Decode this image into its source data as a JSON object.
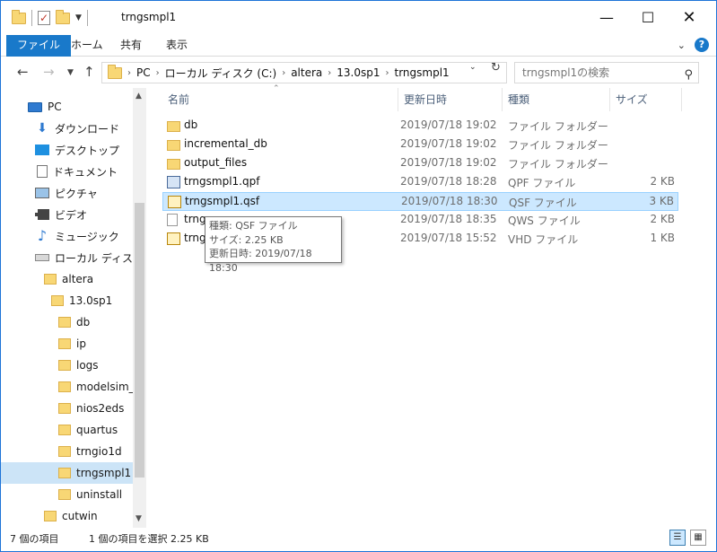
{
  "window": {
    "title": "trngsmpl1",
    "qat_icons": [
      "folder-icon",
      "properties-check-icon",
      "new-folder-icon",
      "customize-qat-icon"
    ],
    "controls": {
      "minimize": "—",
      "maximize": "☐",
      "close": "✕"
    }
  },
  "ribbon": {
    "tabs": [
      "ファイル",
      "ホーム",
      "共有",
      "表示"
    ],
    "active_tab": "ファイル",
    "accent_color": "#1979ca"
  },
  "navigation": {
    "breadcrumbs": [
      "PC",
      "ローカル ディスク (C:)",
      "altera",
      "13.0sp1",
      "trngsmpl1"
    ],
    "search_placeholder": "trngsmpl1の検索"
  },
  "sidebar": {
    "items": [
      {
        "label": "PC",
        "icon": "pc-icon"
      },
      {
        "label": "ダウンロード",
        "icon": "download-icon"
      },
      {
        "label": "デスクトップ",
        "icon": "desktop-icon"
      },
      {
        "label": "ドキュメント",
        "icon": "document-icon"
      },
      {
        "label": "ピクチャ",
        "icon": "pictures-icon"
      },
      {
        "label": "ビデオ",
        "icon": "video-icon"
      },
      {
        "label": "ミュージック",
        "icon": "music-icon"
      },
      {
        "label": "ローカル ディスク (C",
        "icon": "disk-icon"
      },
      {
        "label": "altera",
        "icon": "folder-icon"
      },
      {
        "label": "13.0sp1",
        "icon": "folder-icon"
      },
      {
        "label": "db",
        "icon": "folder-icon"
      },
      {
        "label": "ip",
        "icon": "folder-icon"
      },
      {
        "label": "logs",
        "icon": "folder-icon"
      },
      {
        "label": "modelsim_a",
        "icon": "folder-icon"
      },
      {
        "label": "nios2eds",
        "icon": "folder-icon"
      },
      {
        "label": "quartus",
        "icon": "folder-icon"
      },
      {
        "label": "trngio1d",
        "icon": "folder-icon"
      },
      {
        "label": "trngsmpl1",
        "icon": "folder-icon",
        "selected": true
      },
      {
        "label": "uninstall",
        "icon": "folder-icon"
      },
      {
        "label": "cutwin",
        "icon": "folder-icon"
      }
    ]
  },
  "file_list": {
    "columns": [
      "名前",
      "更新日時",
      "種類",
      "サイズ"
    ],
    "rows": [
      {
        "name": "db",
        "date": "2019/07/18 19:02",
        "type": "ファイル フォルダー",
        "size": "",
        "icon": "folder-icon"
      },
      {
        "name": "incremental_db",
        "date": "2019/07/18 19:02",
        "type": "ファイル フォルダー",
        "size": "",
        "icon": "folder-icon"
      },
      {
        "name": "output_files",
        "date": "2019/07/18 19:02",
        "type": "ファイル フォルダー",
        "size": "",
        "icon": "folder-icon"
      },
      {
        "name": "trngsmpl1.qpf",
        "date": "2019/07/18 18:28",
        "type": "QPF ファイル",
        "size": "2 KB",
        "icon": "qpf-file-icon"
      },
      {
        "name": "trngsmpl1.qsf",
        "date": "2019/07/18 18:30",
        "type": "QSF ファイル",
        "size": "3 KB",
        "icon": "qsf-file-icon",
        "selected": true
      },
      {
        "name": "trngs",
        "date": "2019/07/18 18:35",
        "type": "QWS ファイル",
        "size": "2 KB",
        "icon": "qws-file-icon"
      },
      {
        "name": "trng",
        "date": "2019/07/18 15:52",
        "type": "VHD ファイル",
        "size": "1 KB",
        "icon": "vhd-file-icon"
      }
    ]
  },
  "tooltip": {
    "line1": "種類: QSF ファイル",
    "line2": "サイズ: 2.25 KB",
    "line3": "更新日時: 2019/07/18 18:30"
  },
  "status": {
    "item_count": "7 個の項目",
    "selection": "1 個の項目を選択  2.25 KB"
  }
}
